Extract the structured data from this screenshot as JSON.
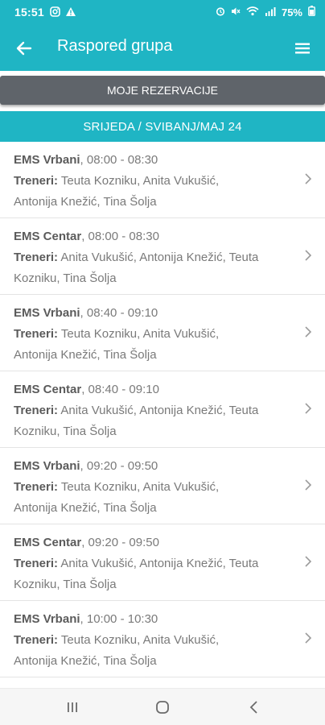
{
  "status_bar": {
    "time": "15:51",
    "battery": "75%",
    "left_icons": [
      "instagram-icon",
      "warning-icon"
    ],
    "right_icons": [
      "alarm-icon",
      "mute-icon",
      "wifi-icon",
      "signal-icon",
      "battery-icon"
    ]
  },
  "app_bar": {
    "title": "Raspored grupa",
    "back_icon": "arrow-left-icon",
    "menu_icon": "hamburger-menu-icon"
  },
  "reservations": {
    "label": "MOJE REZERVACIJE"
  },
  "date_header": {
    "label": "SRIJEDA / SVIBANJ/MAJ 24"
  },
  "trainers_label": "Treneri:",
  "sessions": [
    {
      "location": "EMS Vrbani",
      "time": ", 08:00 - 08:30",
      "trainers_line1": " Teuta Kozniku, Anita Vukušić,",
      "trainers_line2": "Antonija Knežić, Tina Šolja"
    },
    {
      "location": "EMS Centar",
      "time": ", 08:00 - 08:30",
      "trainers_line1": " Anita Vukušić, Antonija Knežić, Teuta",
      "trainers_line2": "Kozniku, Tina Šolja"
    },
    {
      "location": "EMS Vrbani",
      "time": ", 08:40 - 09:10",
      "trainers_line1": " Teuta Kozniku, Anita Vukušić,",
      "trainers_line2": "Antonija Knežić, Tina Šolja"
    },
    {
      "location": "EMS Centar",
      "time": ", 08:40 - 09:10",
      "trainers_line1": " Anita Vukušić, Antonija Knežić, Teuta",
      "trainers_line2": "Kozniku, Tina Šolja"
    },
    {
      "location": "EMS Vrbani",
      "time": ", 09:20 - 09:50",
      "trainers_line1": " Teuta Kozniku, Anita Vukušić,",
      "trainers_line2": "Antonija Knežić, Tina Šolja"
    },
    {
      "location": "EMS Centar",
      "time": ", 09:20 - 09:50",
      "trainers_line1": " Anita Vukušić, Antonija Knežić, Teuta",
      "trainers_line2": "Kozniku, Tina Šolja"
    },
    {
      "location": "EMS Vrbani",
      "time": ", 10:00 - 10:30",
      "trainers_line1": " Teuta Kozniku, Anita Vukušić,",
      "trainers_line2": "Antonija Knežić, Tina Šolja"
    }
  ],
  "nav_bar": {
    "recents_icon": "recents-icon",
    "home_icon": "home-icon",
    "back_icon": "nav-back-icon"
  },
  "colors": {
    "primary": "#1fb5c4",
    "reservations_bg": "#5f646a",
    "text_dark": "#5b5b5b",
    "text_light": "#7a7a7a"
  }
}
